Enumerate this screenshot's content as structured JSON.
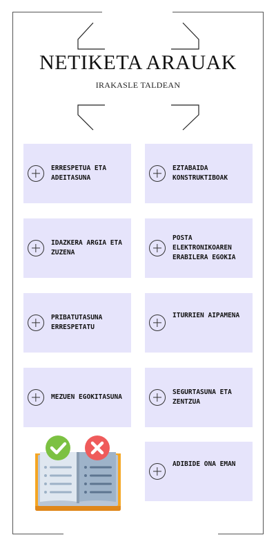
{
  "header": {
    "title": "NETIKETA ARAUAK",
    "subtitle": "IRAKASLE TALDEAN"
  },
  "cards": [
    {
      "label": "ERRESPETUA ETA ADEITASUNA",
      "icon": "plus-circle-icon"
    },
    {
      "label": "EZTABAIDA KONSTRUKTIBOAK",
      "icon": "plus-circle-icon"
    },
    {
      "label": "IDAZKERA ARGIA ETA ZUZENA",
      "icon": "plus-circle-icon"
    },
    {
      "label": "POSTA ELEKTRONIKOAREN ERABILERA EGOKIA",
      "icon": "plus-circle-icon"
    },
    {
      "label": "PRIBATUTASUNA ERRESPETATU",
      "icon": "plus-circle-icon"
    },
    {
      "label": "ITURRIEN AIPAMENA",
      "icon": "plus-circle-icon"
    },
    {
      "label": "MEZUEN EGOKITASUNA",
      "icon": "plus-circle-icon"
    },
    {
      "label": "SEGURTASUNA ETA ZENTZUA",
      "icon": "plus-circle-icon"
    },
    {
      "label": "ADIBIDE ONA EMAN",
      "icon": "plus-circle-icon"
    }
  ],
  "illustration": {
    "icon": "open-book-check-cross-icon"
  },
  "colors": {
    "card_background": "#e6e4fb",
    "check_green": "#7cc142",
    "cross_red": "#ef5b5b",
    "book_orange": "#f5a623"
  }
}
